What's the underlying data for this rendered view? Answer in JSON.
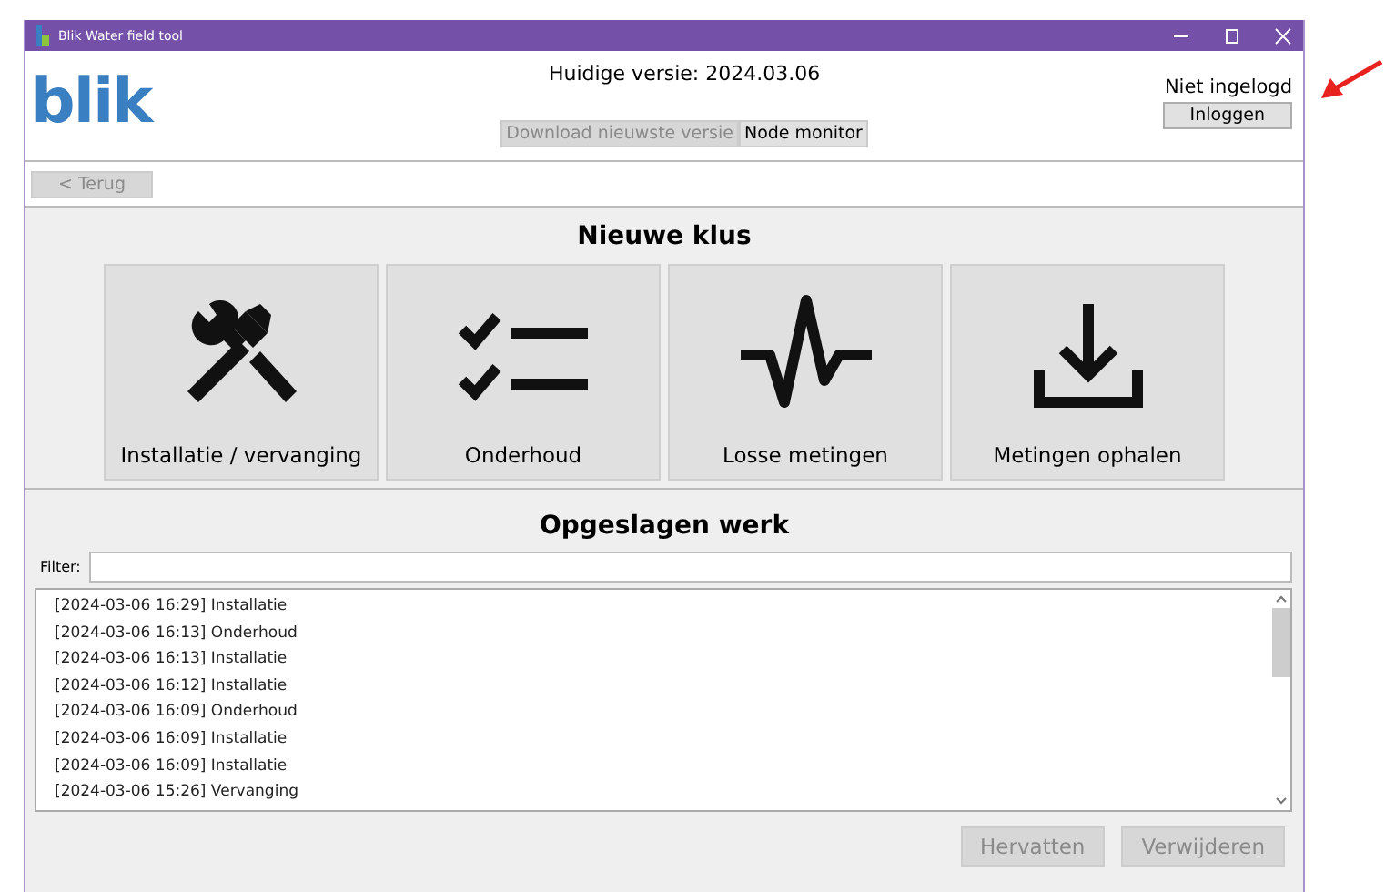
{
  "window": {
    "title": "Blik Water field tool"
  },
  "header": {
    "logo": "blik",
    "version": "Huidige versie: 2024.03.06",
    "buttons": [
      {
        "label": "Download nieuwste versie",
        "disabled": true
      },
      {
        "label": "Node monitor",
        "disabled": false
      }
    ],
    "login_status": "Niet ingelogd",
    "login_button": "Inloggen"
  },
  "back_button": {
    "label": "< Terug",
    "disabled": true
  },
  "new_job": {
    "title": "Nieuwe klus",
    "tiles": [
      {
        "kind": "tools",
        "label": "Installatie / vervanging"
      },
      {
        "kind": "checklist",
        "label": "Onderhoud"
      },
      {
        "kind": "pulse",
        "label": "Losse metingen"
      },
      {
        "kind": "download",
        "label": "Metingen ophalen"
      }
    ]
  },
  "saved_work": {
    "title": "Opgeslagen werk",
    "filter_label": "Filter:",
    "items": [
      "[2024-03-06 16:29] Installatie",
      "[2024-03-06 16:13] Onderhoud",
      "[2024-03-06 16:13] Installatie",
      "[2024-03-06 16:12] Installatie",
      "[2024-03-06 16:09] Onderhoud",
      "[2024-03-06 16:09] Installatie",
      "[2024-03-06 16:09] Installatie",
      "[2024-03-06 15:26] Vervanging"
    ],
    "buttons": [
      {
        "label": "Hervatten",
        "disabled": true
      },
      {
        "label": "Verwijderen",
        "disabled": true
      }
    ]
  }
}
